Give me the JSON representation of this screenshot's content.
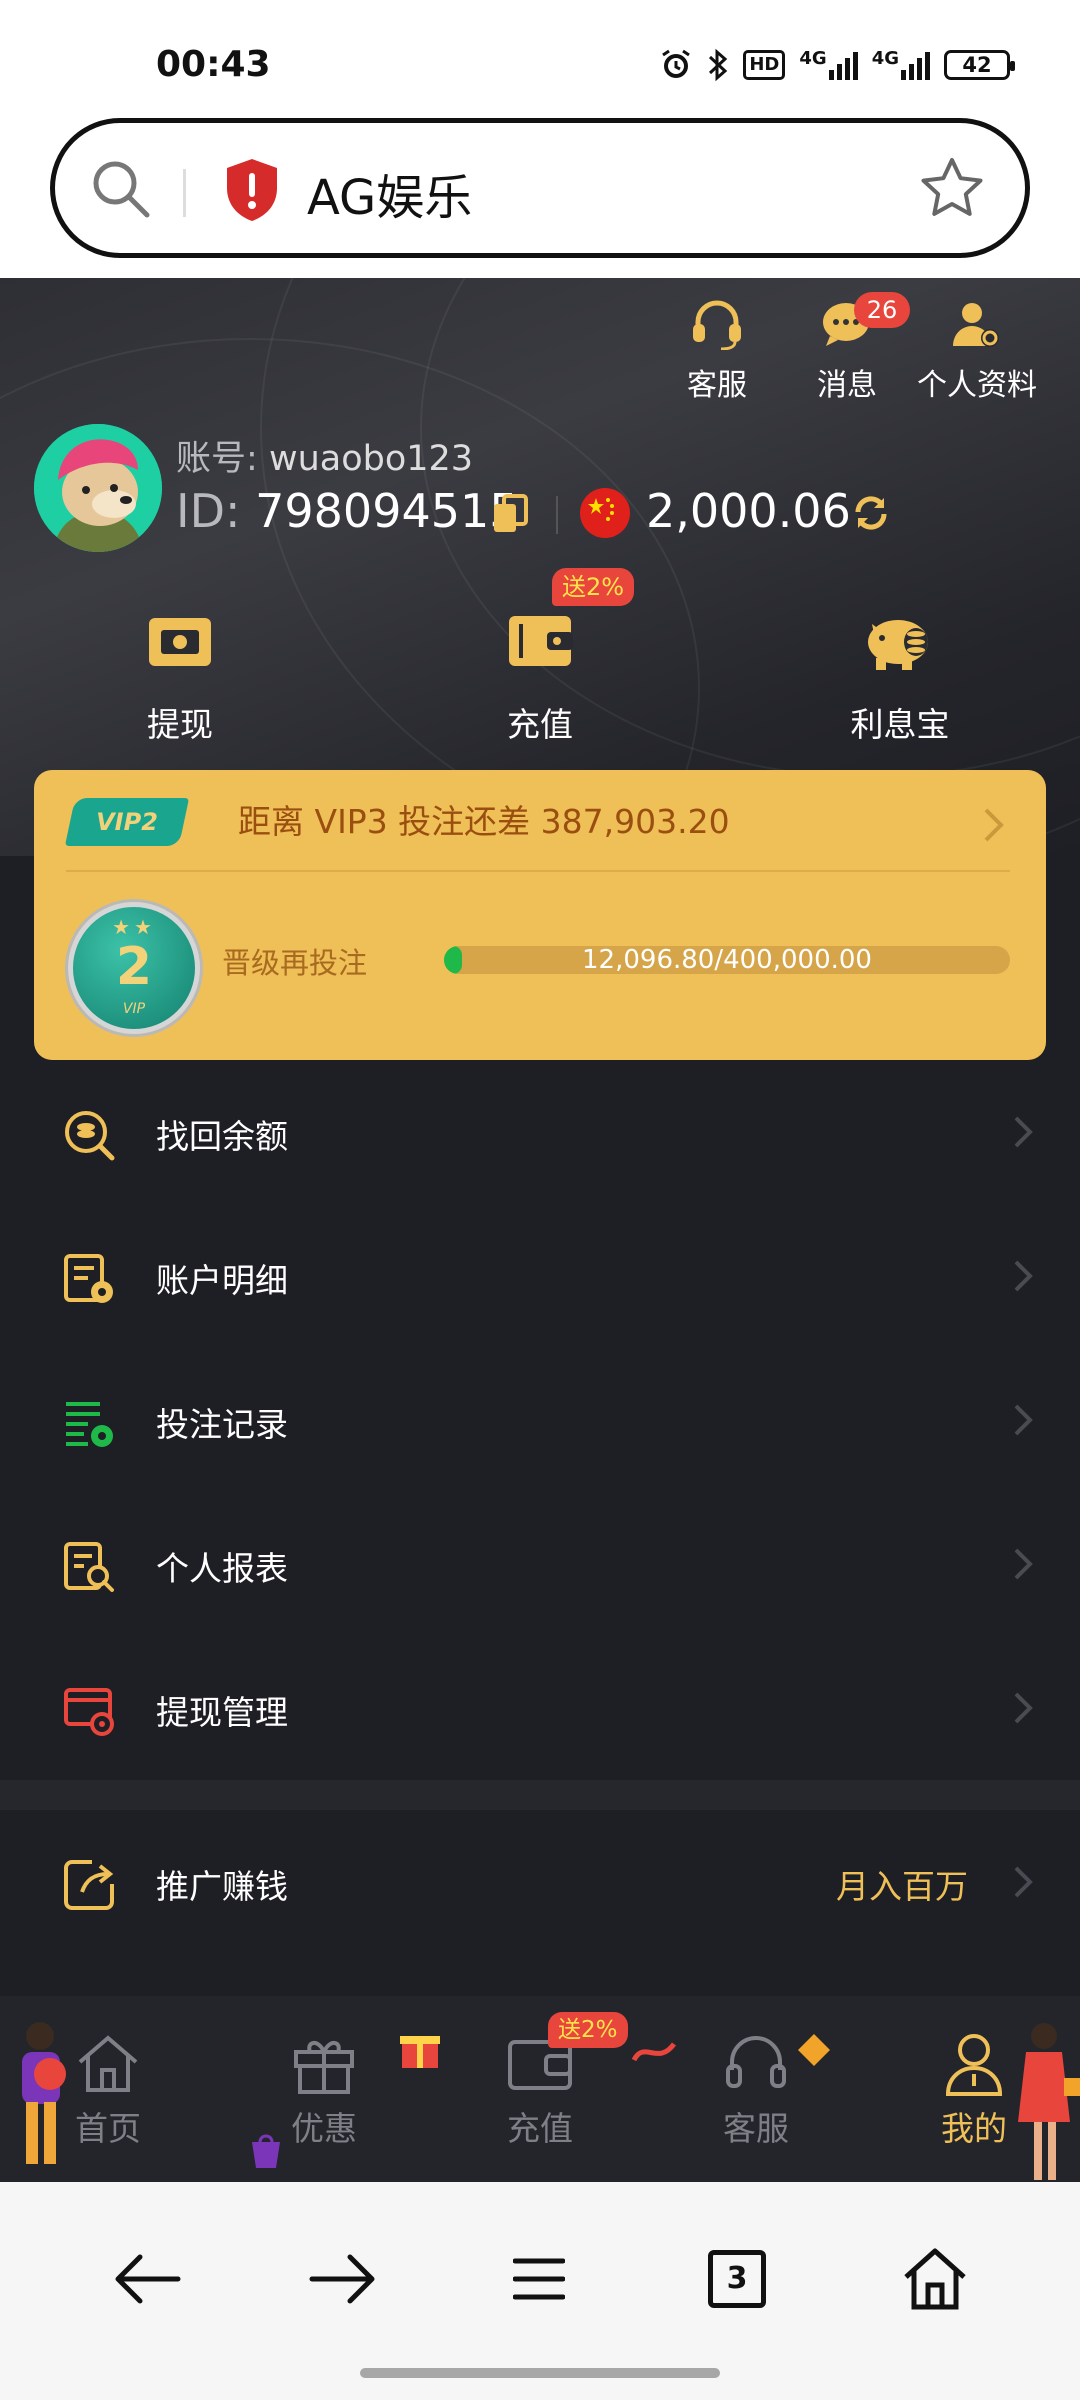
{
  "status_bar": {
    "time": "00:43",
    "battery": "42",
    "net1": "4G",
    "net2": "4G",
    "hd": "HD"
  },
  "browser": {
    "url_text": "AG娱乐",
    "tab_count": "3"
  },
  "header": {
    "top_icons": [
      {
        "label": "客服",
        "icon": "headset-icon"
      },
      {
        "label": "消息",
        "icon": "chat-icon",
        "badge": "26"
      },
      {
        "label": "个人资料",
        "icon": "profile-settings-icon"
      }
    ],
    "account_label": "账号:",
    "account_name": "wuaobo123",
    "id_label": "ID:",
    "id_value": "798094515",
    "balance": "2,000.06",
    "actions": [
      {
        "label": "提现",
        "icon": "withdraw-icon"
      },
      {
        "label": "充值",
        "icon": "wallet-icon",
        "badge": "送2%"
      },
      {
        "label": "利息宝",
        "icon": "piggy-bank-icon"
      }
    ]
  },
  "vip": {
    "tag": "VIP2",
    "message": "距离  VIP3  投注还差 387,903.20",
    "level": "2",
    "medal_caption": "VIP",
    "progress_label": "晋级再投注",
    "progress_text": "12,096.80/400,000.00",
    "progress_fraction": 0.0302
  },
  "menu": [
    {
      "label": "找回余额",
      "icon": "coin-search-icon"
    },
    {
      "label": "账户明细",
      "icon": "account-detail-icon"
    },
    {
      "label": "投注记录",
      "icon": "bet-record-icon"
    },
    {
      "label": "个人报表",
      "icon": "report-search-icon"
    },
    {
      "label": "提现管理",
      "icon": "withdraw-manage-icon"
    }
  ],
  "promo_item": {
    "label": "推广赚钱",
    "extra": "月入百万",
    "icon": "share-icon"
  },
  "tabbar": {
    "tabs": [
      {
        "label": "首页",
        "icon": "home-icon"
      },
      {
        "label": "优惠",
        "icon": "gift-icon"
      },
      {
        "label": "充值",
        "icon": "wallet-icon"
      },
      {
        "label": "客服",
        "icon": "headset-icon"
      },
      {
        "label": "我的",
        "icon": "user-icon"
      }
    ],
    "promo_badge": "送2%"
  },
  "colors": {
    "accent": "#efbf58",
    "danger": "#e8453c",
    "bg": "#1e1f25",
    "success": "#1fb94a"
  }
}
